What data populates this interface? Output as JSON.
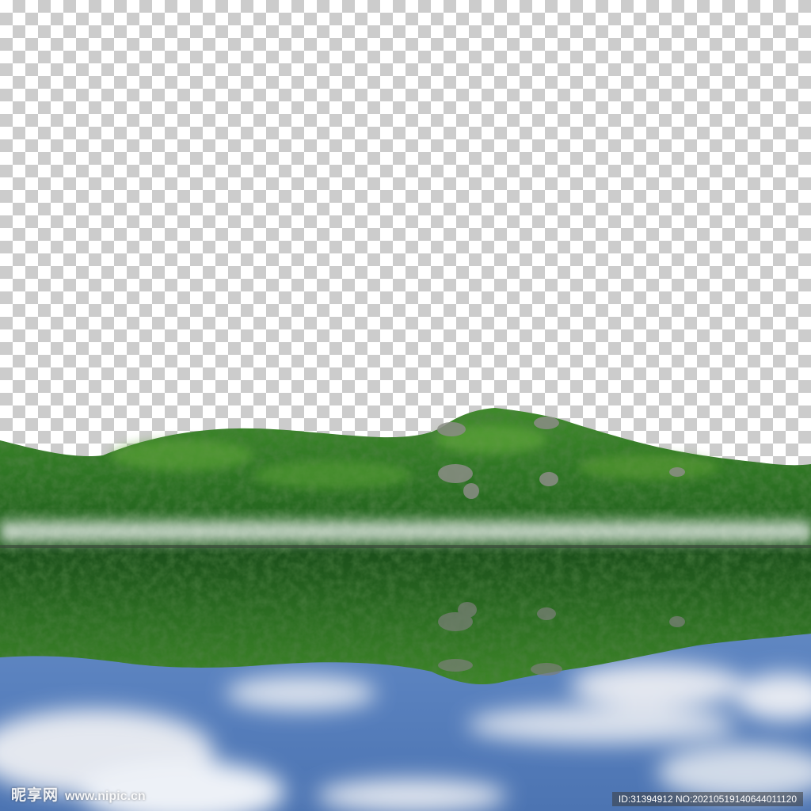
{
  "image": {
    "description_colors": {
      "checker_light": "#ffffff",
      "checker_dark": "#cccccc",
      "forest_dark": "#1f5a1e",
      "forest_light": "#4f9a2e",
      "water_blue": "#5f86c2",
      "mist": "#e9ecef"
    }
  },
  "watermark": {
    "logo_text": "昵享网",
    "url_text": "www.nipic.cn",
    "id_text": "ID:31394912 NO:20210519140644011120"
  }
}
